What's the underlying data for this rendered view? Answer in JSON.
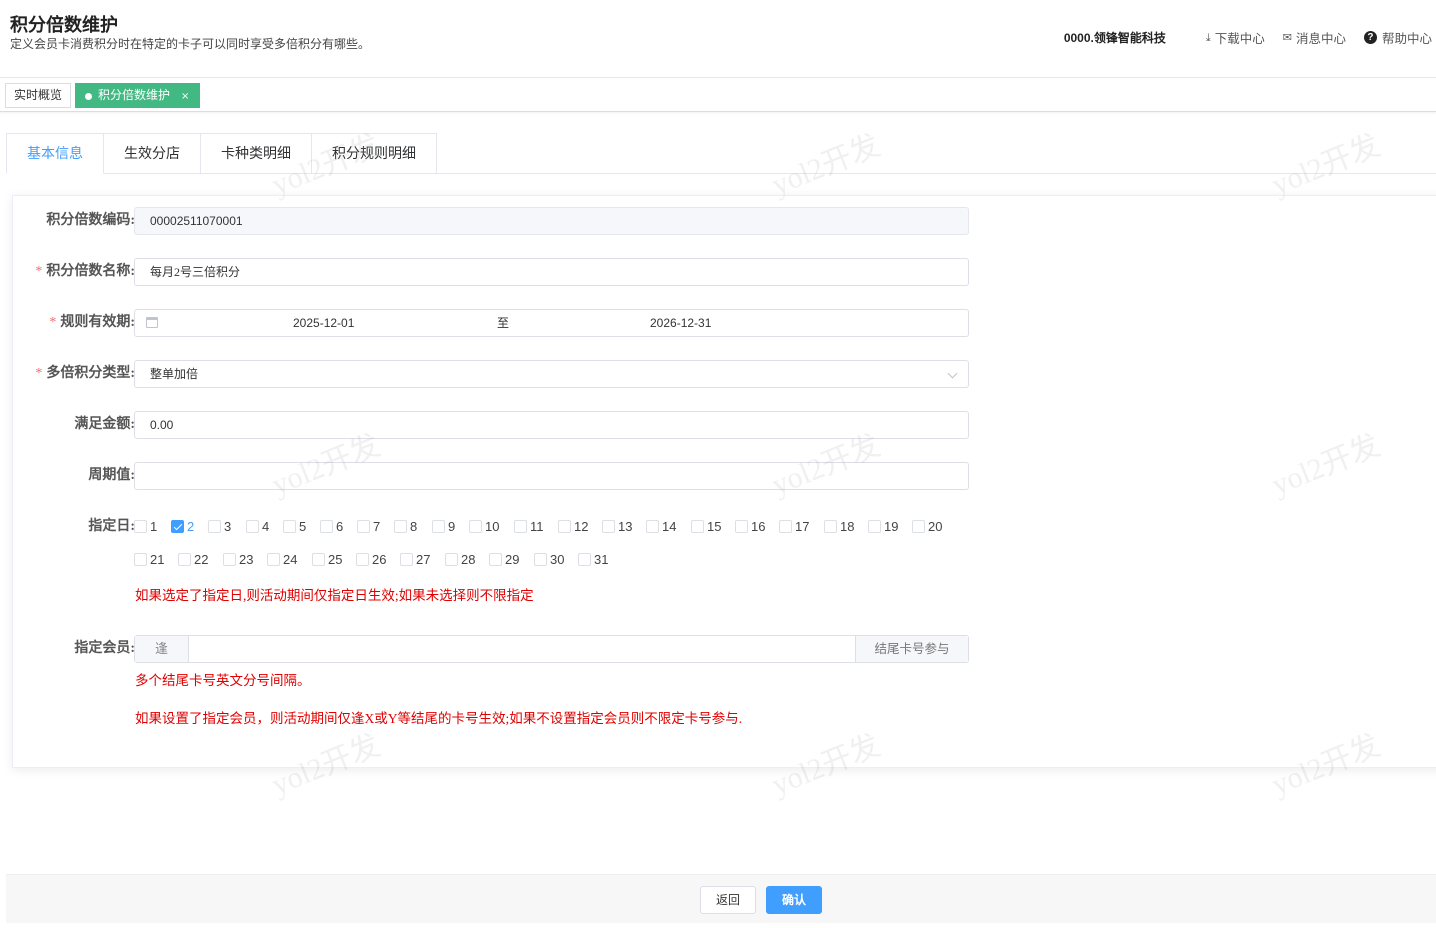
{
  "header": {
    "title": "积分倍数维护",
    "subtitle": "定义会员卡消费积分时在特定的卡子可以同时享受多倍积分有哪些。",
    "company": "0000.领锋智能科技",
    "download": "下载中心",
    "messages": "消息中心",
    "help": "帮助中心"
  },
  "tagsbar": {
    "tags": [
      "实时概览",
      "积分倍数维护"
    ],
    "close": "×"
  },
  "tabs": [
    "基本信息",
    "生效分店",
    "卡种类明细",
    "积分规则明细"
  ],
  "form": {
    "code_label": "积分倍数编码:",
    "code_value": "00002511070001",
    "name_label": "积分倍数名称:",
    "name_value": "每月2号三倍积分",
    "period_label": "规则有效期:",
    "period_start": "2025-12-01",
    "period_sep": "至",
    "period_end": "2026-12-31",
    "type_label": "多倍积分类型:",
    "type_value": "整单加倍",
    "amount_label": "满足金额:",
    "amount_value": "0.00",
    "cycle_label": "周期值:",
    "cycle_value": "",
    "days_label": "指定日:",
    "days": [
      "1",
      "2",
      "3",
      "4",
      "5",
      "6",
      "7",
      "8",
      "9",
      "10",
      "11",
      "12",
      "13",
      "14",
      "15",
      "16",
      "17",
      "18",
      "19",
      "20",
      "21",
      "22",
      "23",
      "24",
      "25",
      "26",
      "27",
      "28",
      "29",
      "30",
      "31"
    ],
    "checked_days": [
      "2"
    ],
    "days_hint": "如果选定了指定日,则活动期间仅指定日生效;如果未选择则不限指定",
    "member_label": "指定会员:",
    "member_prefix": "逢",
    "member_value": "",
    "member_suffix": "结尾卡号参与",
    "member_hint1": "多个结尾卡号英文分号间隔。",
    "member_hint2": "如果设置了指定会员，则活动期间仅逢X或Y等结尾的卡号生效;如果不设置指定会员则不限定卡号参与.",
    "required_mark": "*"
  },
  "footer": {
    "back": "返回",
    "confirm": "确认"
  },
  "watermark": "yol2开发",
  "colors": {
    "primary": "#409eff",
    "tag_active": "#42b983",
    "hint": "#e00000",
    "required": "#f56c6c"
  }
}
